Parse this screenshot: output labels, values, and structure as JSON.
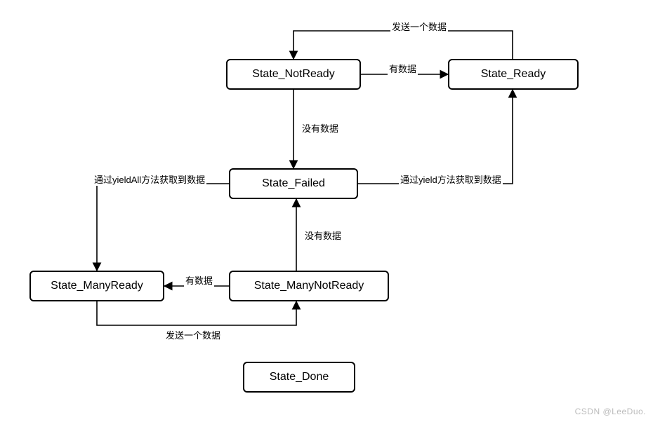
{
  "nodes": {
    "not_ready": "State_NotReady",
    "ready": "State_Ready",
    "failed": "State_Failed",
    "many_ready": "State_ManyReady",
    "many_not_ready": "State_ManyNotReady",
    "done": "State_Done"
  },
  "edges": {
    "not_ready_to_ready": "有数据",
    "not_ready_to_failed": "没有数据",
    "ready_to_not_ready": "发送一个数据",
    "failed_to_ready_via_yield": "通过yield方法获取到数据",
    "failed_to_many_ready_via_yieldAll": "通过yieldAll方法获取到数据",
    "many_not_ready_to_many_ready": "有数据",
    "many_not_ready_to_failed": "没有数据",
    "many_ready_to_many_not_ready": "发送一个数据"
  },
  "watermark": "CSDN @LeeDuo."
}
